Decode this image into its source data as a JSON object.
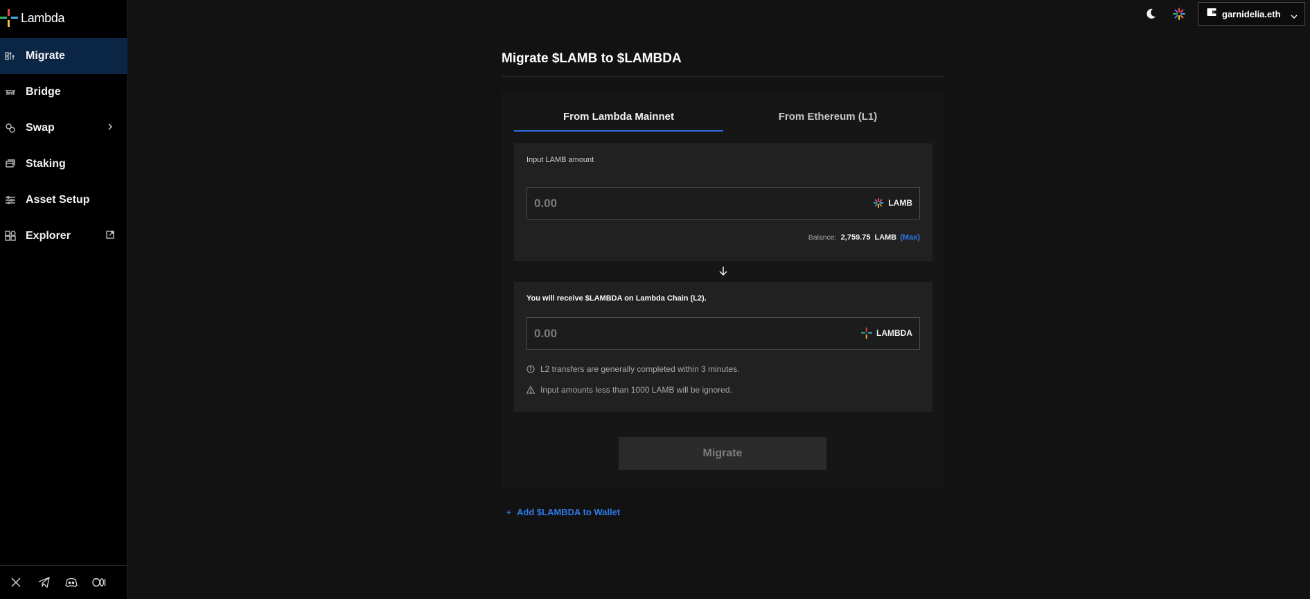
{
  "app": {
    "logo_text": "Lambda"
  },
  "sidebar": {
    "items": [
      {
        "label": "Migrate",
        "icon": "migrate-icon",
        "active": true
      },
      {
        "label": "Bridge",
        "icon": "bridge-icon"
      },
      {
        "label": "Swap",
        "icon": "swap-icon",
        "has_submenu": true
      },
      {
        "label": "Staking",
        "icon": "staking-icon"
      },
      {
        "label": "Asset Setup",
        "icon": "asset-setup-icon"
      },
      {
        "label": "Explorer",
        "icon": "explorer-icon",
        "external": true
      }
    ],
    "social": [
      "x-icon",
      "telegram-icon",
      "discord-icon",
      "medium-icon"
    ]
  },
  "topbar": {
    "theme_icon": "moon-icon",
    "network_icon": "lambda-burst-icon",
    "wallet_label": "garnidelia.eth"
  },
  "main": {
    "title": "Migrate $LAMB to $LAMBDA",
    "tabs": [
      {
        "label": "From Lambda Mainnet",
        "active": true
      },
      {
        "label": "From Ethereum (L1)",
        "active": false
      }
    ],
    "input": {
      "label": "Input LAMB amount",
      "placeholder": "0.00",
      "token": "LAMB",
      "balance_label": "Balance:",
      "balance_value": "2,759.75",
      "balance_unit": "LAMB",
      "max_label": "(Max)"
    },
    "output": {
      "label": "You will receive $LAMBDA on Lambda Chain (L2).",
      "placeholder": "0.00",
      "token": "LAMBDA"
    },
    "notices": [
      {
        "icon": "info-icon",
        "text": "L2 transfers are generally completed within 3 minutes."
      },
      {
        "icon": "warning-icon",
        "text": "Input amounts less than 1000 LAMB will be ignored."
      }
    ],
    "submit_label": "Migrate",
    "add_wallet_label": "Add $LAMBDA to Wallet"
  },
  "colors": {
    "accent": "#2f7ae8",
    "active_nav_bg": "#0b2544",
    "panel_bg": "#161616",
    "box_bg": "#212121"
  }
}
